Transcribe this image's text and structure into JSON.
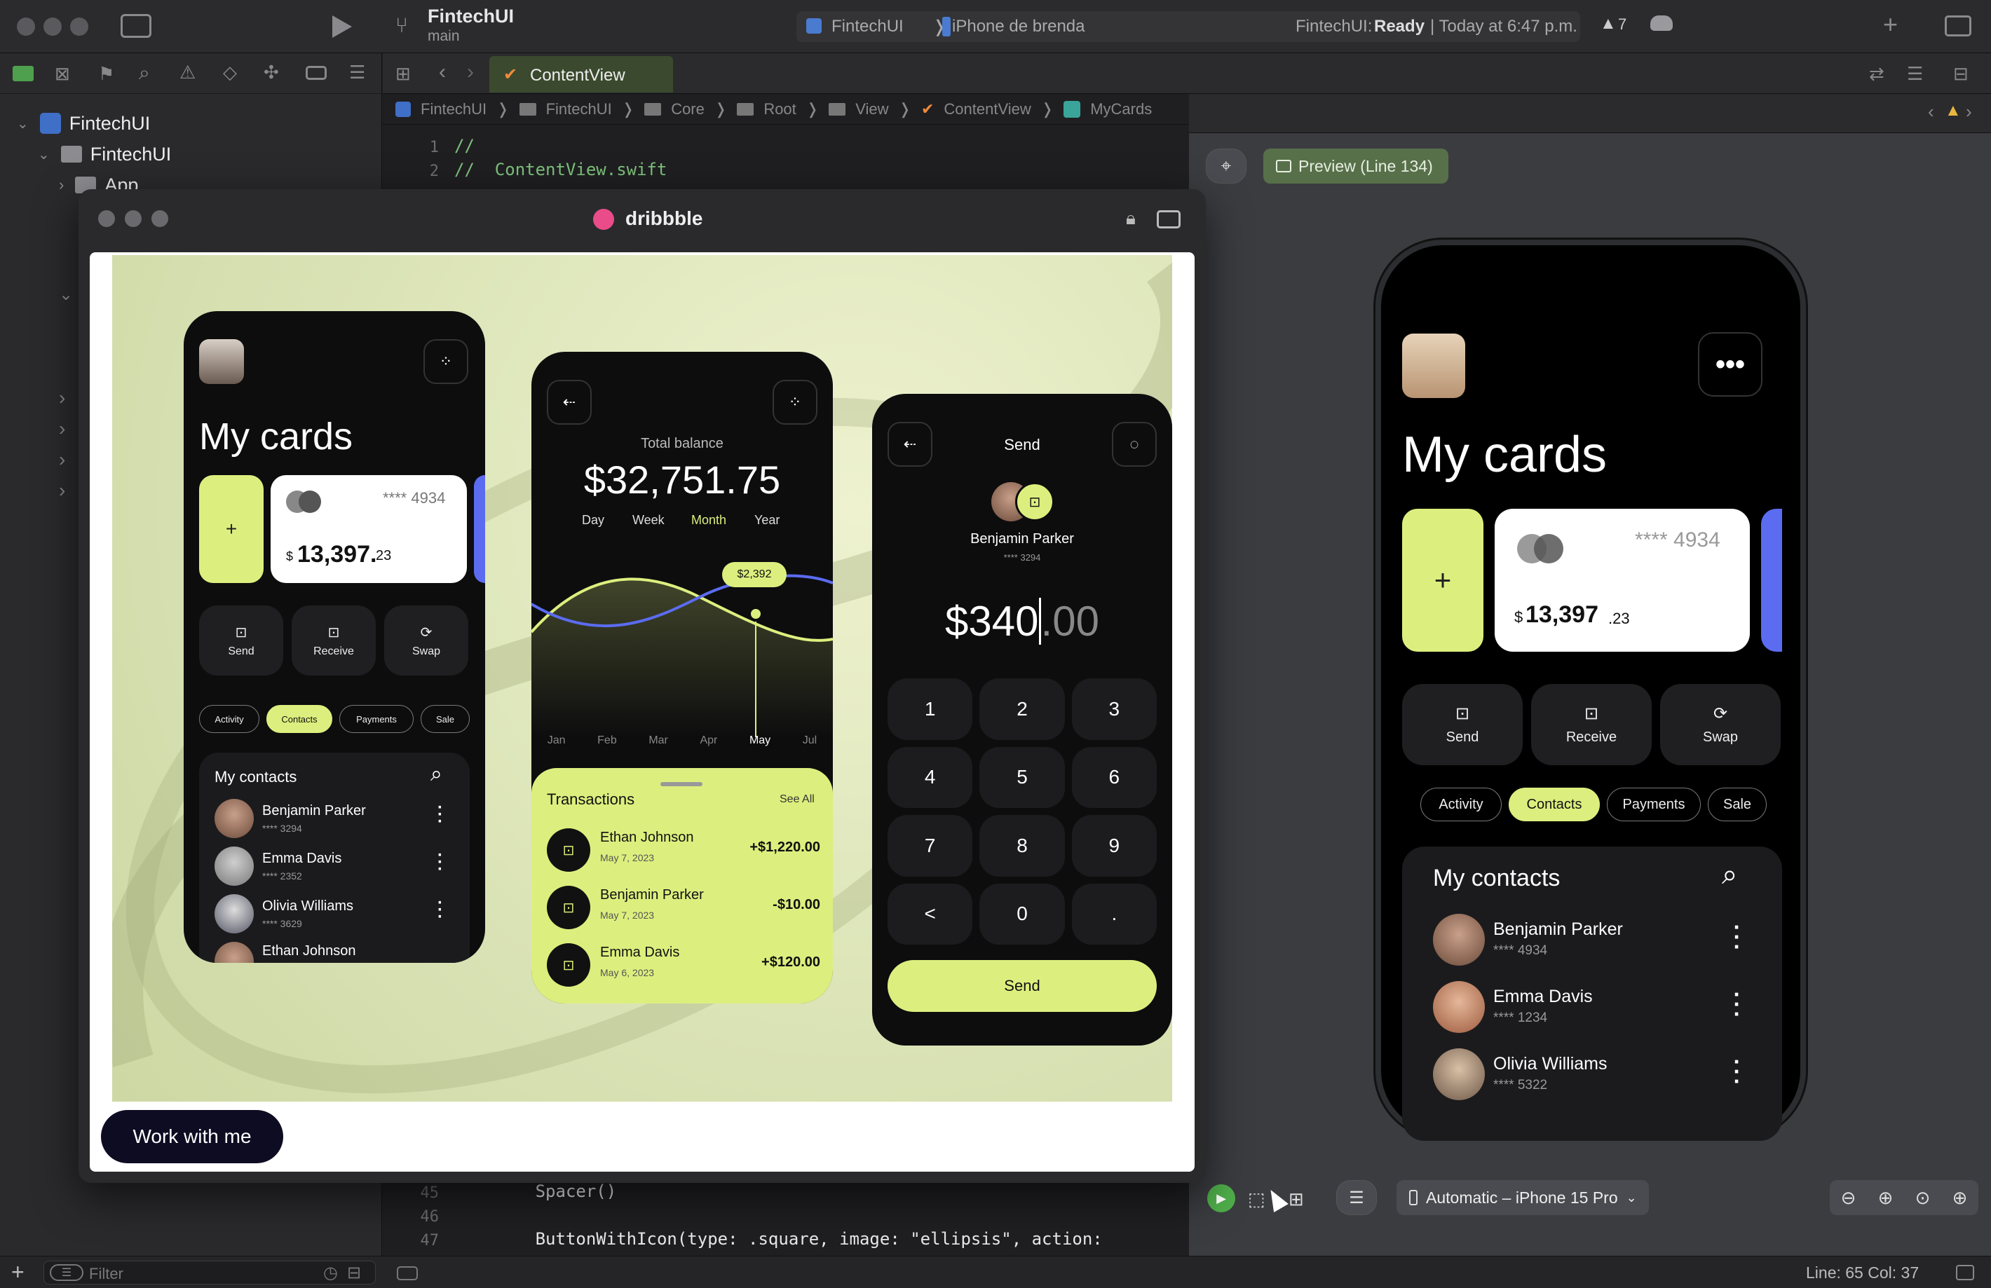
{
  "xcode": {
    "project": "FintechUI",
    "branch": "main",
    "scheme": "FintechUI",
    "device": "iPhone de brenda",
    "status_app": "FintechUI:",
    "status_ready": "Ready",
    "status_time": "| Today at 6:47 p.m.",
    "warnings": "7",
    "tab": "ContentView",
    "breadcrumb": [
      "FintechUI",
      "FintechUI",
      "Core",
      "Root",
      "View",
      "ContentView",
      "MyCards"
    ],
    "navigator": [
      "FintechUI",
      "FintechUI",
      "App"
    ],
    "filter_placeholder": "Filter",
    "code_top": [
      {
        "n": "1",
        "t": "//"
      },
      {
        "n": "2",
        "t": "//  ContentView.swift"
      }
    ],
    "code_bottom": [
      {
        "n": "45",
        "t": "        Spacer()"
      },
      {
        "n": "46",
        "t": ""
      },
      {
        "n": "47",
        "t": "        ButtonWithIcon(type: .square, image: \"ellipsis\", action:"
      }
    ],
    "preview_label": "Preview (Line 134)",
    "preview_device": "Automatic – iPhone 15 Pro",
    "cursor_pos": "Line: 65  Col: 37"
  },
  "browser": {
    "site": "dribbble",
    "cta": "Work with me"
  },
  "shot": {
    "phone1": {
      "title": "My cards",
      "add": "+",
      "card_mask": "**** 4934",
      "card_currency": "$",
      "card_amount": "13,397.",
      "card_cents": "23",
      "actions": [
        "Send",
        "Receive",
        "Swap"
      ],
      "tabs": [
        "Activity",
        "Contacts",
        "Payments",
        "Sale"
      ],
      "contacts_title": "My contacts",
      "contacts": [
        {
          "name": "Benjamin Parker",
          "num": "**** 3294"
        },
        {
          "name": "Emma Davis",
          "num": "**** 2352"
        },
        {
          "name": "Olivia Williams",
          "num": "**** 3629"
        },
        {
          "name": "Ethan Johnson",
          "num": ""
        }
      ]
    },
    "phone2": {
      "balance_label": "Total balance",
      "balance": "$32,751.75",
      "periods": [
        "Day",
        "Week",
        "Month",
        "Year"
      ],
      "tooltip": "$2,392",
      "months": [
        "Jan",
        "Feb",
        "Mar",
        "Apr",
        "May",
        "Jul"
      ],
      "tx_title": "Transactions",
      "see_all": "See All",
      "transactions": [
        {
          "name": "Ethan Johnson",
          "date": "May 7, 2023",
          "amount": "+$1,220.00"
        },
        {
          "name": "Benjamin Parker",
          "date": "May 7, 2023",
          "amount": "-$10.00"
        },
        {
          "name": "Emma Davis",
          "date": "May 6, 2023",
          "amount": "+$120.00"
        }
      ]
    },
    "phone3": {
      "title": "Send",
      "recipient": "Benjamin Parker",
      "recipient_num": "**** 3294",
      "amount_main": "$340",
      "amount_cents": ".00",
      "keys": [
        "1",
        "2",
        "3",
        "4",
        "5",
        "6",
        "7",
        "8",
        "9",
        "<",
        "0",
        "."
      ],
      "send": "Send"
    }
  },
  "preview": {
    "title": "My cards",
    "add": "+",
    "card_mask": "**** 4934",
    "card_currency": "$",
    "card_amount": "13,397",
    "card_cents": ".23",
    "actions": [
      "Send",
      "Receive",
      "Swap"
    ],
    "tabs": [
      "Activity",
      "Contacts",
      "Payments",
      "Sale"
    ],
    "contacts_title": "My contacts",
    "contacts": [
      {
        "name": "Benjamin Parker",
        "num": "**** 4934"
      },
      {
        "name": "Emma Davis",
        "num": "**** 1234"
      },
      {
        "name": "Olivia Williams",
        "num": "**** 5322"
      }
    ]
  },
  "colors": {
    "accent_lime": "#dcef7e",
    "accent_blue": "#5b6cf0",
    "xcode_bg": "#1e1f22"
  }
}
